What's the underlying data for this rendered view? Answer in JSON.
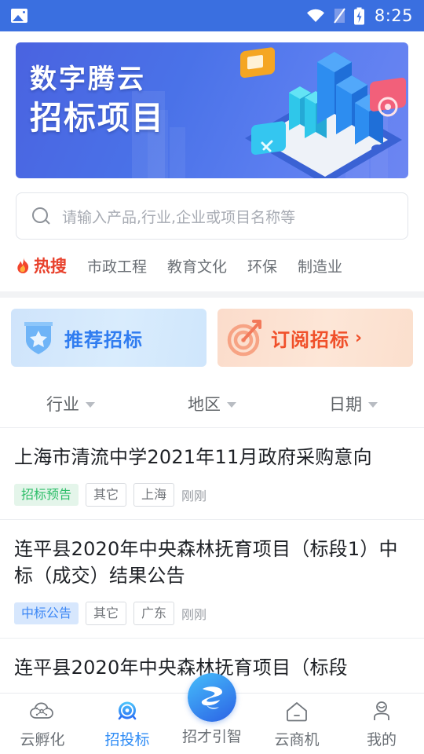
{
  "statusbar": {
    "image_icon": "image-icon",
    "wifi_icon": "wifi-icon",
    "signal_icon": "signal-icon",
    "battery_icon": "battery-charging-icon",
    "time": "8:25"
  },
  "banner": {
    "line1": "数字腾云",
    "line2": "招标项目",
    "art": "isometric-bar-chart-illustration"
  },
  "search": {
    "placeholder": "请输入产品,行业,企业或项目名称等",
    "icon": "search-icon",
    "value": ""
  },
  "hot_search": {
    "icon": "flame-icon",
    "label": "热搜",
    "keywords": [
      "市政工程",
      "教育文化",
      "环保",
      "制造业"
    ]
  },
  "promos": [
    {
      "label": "推荐招标",
      "icon": "shield-star-icon",
      "chevron": ""
    },
    {
      "label": "订阅招标",
      "icon": "target-arrow-icon",
      "chevron": "›"
    }
  ],
  "filters": [
    {
      "label": "行业",
      "icon": "chevron-down-icon"
    },
    {
      "label": "地区",
      "icon": "chevron-down-icon"
    },
    {
      "label": "日期",
      "icon": "chevron-down-icon"
    }
  ],
  "list": [
    {
      "title": "上海市清流中学2021年11月政府采购意向",
      "status_tag": "招标预告",
      "status_style": "green",
      "category": "其它",
      "region": "上海",
      "time": "刚刚"
    },
    {
      "title": "连平县2020年中央森林抚育项目（标段1）中标（成交）结果公告",
      "status_tag": "中标公告",
      "status_style": "blue",
      "category": "其它",
      "region": "广东",
      "time": "刚刚"
    },
    {
      "title": "连平县2020年中央森林抚育项目（标段",
      "status_tag": "",
      "status_style": "",
      "category": "",
      "region": "",
      "time": ""
    }
  ],
  "tabbar": [
    {
      "label": "云孵化",
      "icon": "cloud-network-icon",
      "active": false
    },
    {
      "label": "招投标",
      "icon": "radar-target-icon",
      "active": true
    },
    {
      "label": "招才引智",
      "icon": "brand-logo-icon",
      "active": false
    },
    {
      "label": "云商机",
      "icon": "home-icon",
      "active": false
    },
    {
      "label": "我的",
      "icon": "person-icon",
      "active": false
    }
  ],
  "colors": {
    "status_bar": "#3a6fe0",
    "accent_blue": "#2f8cf5",
    "accent_orange": "#f0502a",
    "tag_green": "#2fbe6a",
    "tag_blue": "#3c87f5",
    "page_bg": "#f2f3f5"
  }
}
